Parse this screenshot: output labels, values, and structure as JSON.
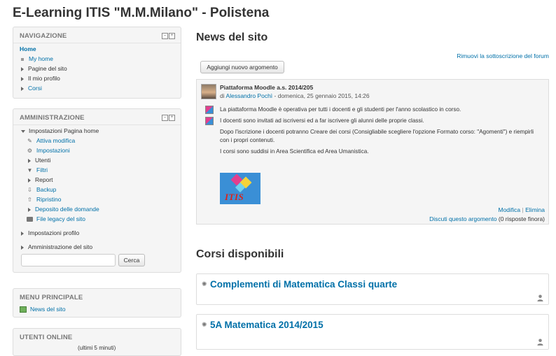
{
  "site": {
    "title": "E-Learning ITIS \"M.M.Milano\" - Polistena"
  },
  "navigation": {
    "title": "NAVIGAZIONE",
    "home": "Home",
    "items": [
      {
        "label": "My home",
        "link": true
      },
      {
        "label": "Pagine del sito",
        "link": false
      },
      {
        "label": "Il mio profilo",
        "link": false
      },
      {
        "label": "Corsi",
        "link": true
      }
    ]
  },
  "admin": {
    "title": "AMMINISTRAZIONE",
    "home_settings": "Impostazioni Pagina home",
    "items": [
      {
        "label": "Attiva modifica",
        "icon": "pencil-icon"
      },
      {
        "label": "Impostazioni",
        "icon": "gear-icon"
      },
      {
        "label": "Utenti",
        "icon": "triangle"
      },
      {
        "label": "Filtri",
        "icon": "filter-icon"
      },
      {
        "label": "Report",
        "icon": "triangle"
      },
      {
        "label": "Backup",
        "icon": "backup-icon"
      },
      {
        "label": "Ripristino",
        "icon": "restore-icon"
      },
      {
        "label": "Deposito delle domande",
        "icon": "triangle"
      },
      {
        "label": "File legacy del sito",
        "icon": "folder-icon"
      }
    ],
    "profile_settings": "Impostazioni profilo",
    "site_admin": "Amministrazione del sito",
    "search_placeholder": "",
    "search_button": "Cerca"
  },
  "main_menu": {
    "title": "MENU PRINCIPALE",
    "item": "News del sito"
  },
  "online_users": {
    "title": "UTENTI ONLINE",
    "subtitle": "(ultimi 5 minuti)"
  },
  "news": {
    "heading": "News del sito",
    "unsubscribe": "Rimuovi la sottoscrizione del forum",
    "add_topic": "Aggiungi nuovo argomento",
    "post": {
      "subject": "Piattaforma Moodle a.s. 2014/205",
      "by": "di",
      "author": "Alessandro Pochì",
      "date": "- domenica, 25 gennaio 2015, 14:26",
      "paragraphs": [
        "La piattaforma Moodle è operativa per tutti i docenti e gli studenti per l'anno scolastico in corso.",
        "I docenti sono invitati ad iscriversi ed a far iscrivere gli alunni delle proprie classi.",
        "Dopo l'iscrizione i docenti potranno Creare dei corsi (Consigliabile scegliere l'opzione Formato corso: \"Agomenti\") e riempirli con i propri contenuti.",
        "I corsi sono suddisi in Area Scientifica ed Area Umanistica."
      ],
      "logo_text": "ITIS",
      "edit": "Modifica",
      "separator": "|",
      "delete": "Elimina",
      "discuss": "Discuti questo argomento",
      "replies": "(0 risposte finora)"
    }
  },
  "courses": {
    "heading": "Corsi disponibili",
    "list": [
      {
        "name": "Complementi di Matematica Classi quarte"
      },
      {
        "name": "5A Matematica 2014/2015"
      }
    ]
  }
}
